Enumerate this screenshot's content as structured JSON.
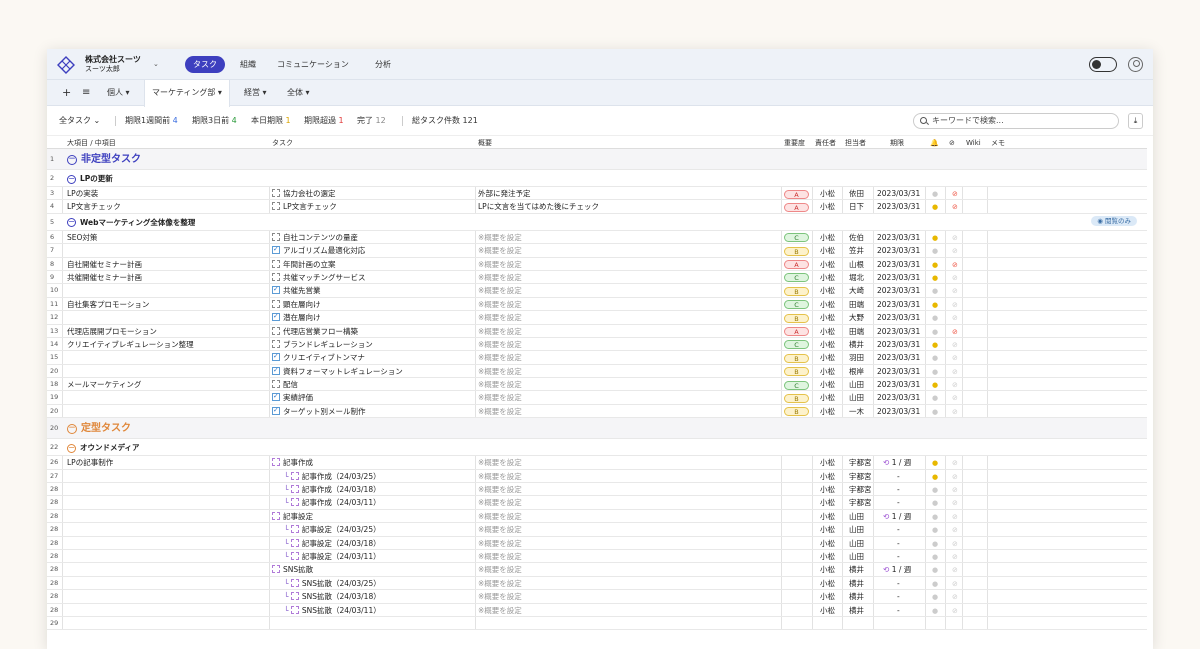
{
  "app": {
    "company": "株式会社スーツ",
    "user": "スーツ太郎",
    "nav_tabs": [
      "タスク",
      "組織",
      "コミュニケーション",
      "分析"
    ]
  },
  "viewbar": {
    "tabs": [
      "個人",
      "マーケティング部",
      "経営",
      "全体"
    ]
  },
  "filterbar": {
    "all_tasks": "全タスク",
    "week_label": "期限1週間前",
    "week_count": "4",
    "three_label": "期限3日前",
    "three_count": "4",
    "today_label": "本日期限",
    "today_count": "1",
    "over_label": "期限超過",
    "over_count": "1",
    "done_label": "完了",
    "done_count": "12",
    "total_label": "総タスク件数",
    "total_count": "121",
    "search_placeholder": "キーワードで検索..."
  },
  "columns": {
    "category": "大項目 / 中項目",
    "task": "タスク",
    "summary": "概要",
    "priority": "重要度",
    "owner": "責任者",
    "assignee": "担当者",
    "due": "期限",
    "wiki": "Wiki",
    "memo": "メモ"
  },
  "readonly_badge": "閲覧のみ",
  "placeholder": "※概要を設定",
  "colors": {
    "accent": "#3d3fbf",
    "section1": "#3d3fbf",
    "section2": "#e0873a"
  },
  "rows": [
    {
      "n": "1",
      "kind": "sec",
      "title": "非定型タスク",
      "color": "#3d3fbf"
    },
    {
      "n": "2",
      "kind": "grp",
      "title": "LPの更新"
    },
    {
      "n": "3",
      "cat": "LPの実装",
      "task": "協力会社の選定",
      "summary": "外部に発注予定",
      "pri": "A",
      "owner": "小松",
      "assignee": "依田",
      "due": "2023/03/31",
      "bell": "0",
      "mute": "1"
    },
    {
      "n": "4",
      "cat": "LP文言チェック",
      "task": "LP文言チェック",
      "summary": "LPに文言を当てはめた後にチェック",
      "pri": "A",
      "owner": "小松",
      "assignee": "日下",
      "due": "2023/03/31",
      "bell": "1",
      "mute": "1"
    },
    {
      "n": "5",
      "kind": "grp",
      "title": "Webマーケティング全体像を整理",
      "badge": true
    },
    {
      "n": "6",
      "cat": "SEO対策",
      "task": "自社コンテンツの量産",
      "summary": "",
      "pri": "C",
      "owner": "小松",
      "assignee": "佐伯",
      "due": "2023/03/31",
      "bell": "1",
      "mute": "0"
    },
    {
      "n": "7",
      "cat": "",
      "task": "アルゴリズム最適化対応",
      "done": true,
      "summary": "",
      "pri": "B",
      "owner": "小松",
      "assignee": "笠井",
      "due": "2023/03/31",
      "bell": "0",
      "mute": "0"
    },
    {
      "n": "8",
      "cat": "自社開催セミナー計画",
      "task": "年間計画の立案",
      "summary": "",
      "pri": "A",
      "owner": "小松",
      "assignee": "山根",
      "due": "2023/03/31",
      "bell": "1",
      "mute": "1"
    },
    {
      "n": "9",
      "cat": "共催開催セミナー計画",
      "task": "共催マッチングサービス",
      "summary": "",
      "pri": "C",
      "owner": "小松",
      "assignee": "堀北",
      "due": "2023/03/31",
      "bell": "1",
      "mute": "0"
    },
    {
      "n": "10",
      "cat": "",
      "task": "共催先営業",
      "done": true,
      "summary": "",
      "pri": "B",
      "owner": "小松",
      "assignee": "大崎",
      "due": "2023/03/31",
      "bell": "0",
      "mute": "0"
    },
    {
      "n": "11",
      "cat": "自社集客プロモーション",
      "task": "顕在層向け",
      "summary": "",
      "pri": "C",
      "owner": "小松",
      "assignee": "田端",
      "due": "2023/03/31",
      "bell": "1",
      "mute": "0"
    },
    {
      "n": "12",
      "cat": "",
      "task": "潜在層向け",
      "done": true,
      "summary": "",
      "pri": "B",
      "owner": "小松",
      "assignee": "大野",
      "due": "2023/03/31",
      "bell": "0",
      "mute": "0"
    },
    {
      "n": "13",
      "cat": "代理店展開プロモーション",
      "task": "代理店営業フロー構築",
      "summary": "",
      "pri": "A",
      "owner": "小松",
      "assignee": "田端",
      "due": "2023/03/31",
      "bell": "0",
      "mute": "1"
    },
    {
      "n": "14",
      "cat": "クリエイティブレギュレーション整理",
      "task": "ブランドレギュレーション",
      "summary": "",
      "pri": "C",
      "owner": "小松",
      "assignee": "横井",
      "due": "2023/03/31",
      "bell": "1",
      "mute": "0"
    },
    {
      "n": "15",
      "cat": "",
      "task": "クリエイティブトンマナ",
      "done": true,
      "summary": "",
      "pri": "B",
      "owner": "小松",
      "assignee": "羽田",
      "due": "2023/03/31",
      "bell": "0",
      "mute": "0"
    },
    {
      "n": "20",
      "cat": "",
      "task": "資料フォーマットレギュレーション",
      "done": true,
      "summary": "",
      "pri": "B",
      "owner": "小松",
      "assignee": "根岸",
      "due": "2023/03/31",
      "bell": "0",
      "mute": "0"
    },
    {
      "n": "18",
      "cat": "メールマーケティング",
      "task": "配信",
      "summary": "",
      "pri": "C",
      "owner": "小松",
      "assignee": "山田",
      "due": "2023/03/31",
      "bell": "1",
      "mute": "0"
    },
    {
      "n": "19",
      "cat": "",
      "task": "実績評価",
      "done": true,
      "summary": "",
      "pri": "B",
      "owner": "小松",
      "assignee": "山田",
      "due": "2023/03/31",
      "bell": "0",
      "mute": "0"
    },
    {
      "n": "20",
      "cat": "",
      "task": "ターゲット別メール制作",
      "done": true,
      "summary": "",
      "pri": "B",
      "owner": "小松",
      "assignee": "一木",
      "due": "2023/03/31",
      "bell": "0",
      "mute": "0"
    },
    {
      "n": "20",
      "kind": "sec",
      "title": "定型タスク",
      "color": "#e0873a"
    },
    {
      "n": "22",
      "kind": "grp",
      "title": "オウンドメディア"
    },
    {
      "n": "26",
      "cat": "LPの記事制作",
      "task": "記事作成",
      "level": 0,
      "summary": "",
      "pri": "",
      "owner": "小松",
      "assignee": "宇都宮",
      "due": "1 / 週",
      "rep": true,
      "bell": "1",
      "mute": "0"
    },
    {
      "n": "27",
      "cat": "",
      "task": "記事作成（24/03/25）",
      "level": 1,
      "summary": "",
      "pri": "",
      "owner": "小松",
      "assignee": "宇都宮",
      "due": "-",
      "bell": "1",
      "mute": "0"
    },
    {
      "n": "28",
      "cat": "",
      "task": "記事作成（24/03/18）",
      "level": 1,
      "summary": "",
      "pri": "",
      "owner": "小松",
      "assignee": "宇都宮",
      "due": "-",
      "bell": "0",
      "mute": "0"
    },
    {
      "n": "28",
      "cat": "",
      "task": "記事作成（24/03/11）",
      "level": 1,
      "summary": "",
      "pri": "",
      "owner": "小松",
      "assignee": "宇都宮",
      "due": "-",
      "bell": "0",
      "mute": "0"
    },
    {
      "n": "28",
      "cat": "",
      "task": "記事設定",
      "level": 0,
      "summary": "",
      "pri": "",
      "owner": "小松",
      "assignee": "山田",
      "due": "1 / 週",
      "rep": true,
      "bell": "0",
      "mute": "0"
    },
    {
      "n": "28",
      "cat": "",
      "task": "記事設定（24/03/25）",
      "level": 1,
      "summary": "",
      "pri": "",
      "owner": "小松",
      "assignee": "山田",
      "due": "-",
      "bell": "0",
      "mute": "0"
    },
    {
      "n": "28",
      "cat": "",
      "task": "記事設定（24/03/18）",
      "level": 1,
      "summary": "",
      "pri": "",
      "owner": "小松",
      "assignee": "山田",
      "due": "-",
      "bell": "0",
      "mute": "0"
    },
    {
      "n": "28",
      "cat": "",
      "task": "記事設定（24/03/11）",
      "level": 1,
      "summary": "",
      "pri": "",
      "owner": "小松",
      "assignee": "山田",
      "due": "-",
      "bell": "0",
      "mute": "0"
    },
    {
      "n": "28",
      "cat": "",
      "task": "SNS拡散",
      "level": 0,
      "summary": "",
      "pri": "",
      "owner": "小松",
      "assignee": "横井",
      "due": "1 / 週",
      "rep": true,
      "bell": "0",
      "mute": "0"
    },
    {
      "n": "28",
      "cat": "",
      "task": "SNS拡散（24/03/25）",
      "level": 1,
      "summary": "",
      "pri": "",
      "owner": "小松",
      "assignee": "横井",
      "due": "-",
      "bell": "0",
      "mute": "0"
    },
    {
      "n": "28",
      "cat": "",
      "task": "SNS拡散（24/03/18）",
      "level": 1,
      "summary": "",
      "pri": "",
      "owner": "小松",
      "assignee": "横井",
      "due": "-",
      "bell": "0",
      "mute": "0"
    },
    {
      "n": "28",
      "cat": "",
      "task": "SNS拡散（24/03/11）",
      "level": 1,
      "summary": "",
      "pri": "",
      "owner": "小松",
      "assignee": "横井",
      "due": "-",
      "bell": "0",
      "mute": "0"
    },
    {
      "n": "29",
      "kind": "empty"
    }
  ]
}
